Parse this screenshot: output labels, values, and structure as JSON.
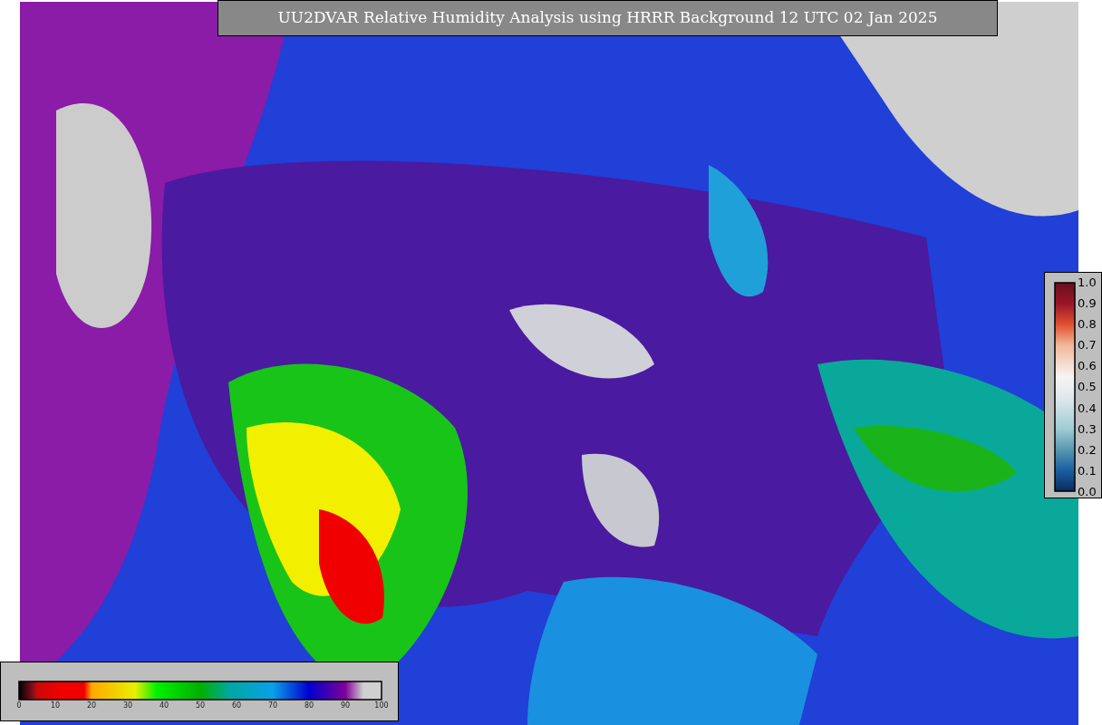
{
  "title": "UU2DVAR Relative Humidity Analysis using HRRR Background 12 UTC 02 Jan 2025",
  "humidity_colorbar": {
    "ticks": [
      "0",
      "10",
      "20",
      "30",
      "40",
      "50",
      "60",
      "70",
      "80",
      "90",
      "100"
    ]
  },
  "ratio_colorbar": {
    "ticks": [
      "1.0",
      "0.9",
      "0.8",
      "0.7",
      "0.6",
      "0.5",
      "0.4",
      "0.3",
      "0.2",
      "0.1",
      "0.0"
    ]
  }
}
